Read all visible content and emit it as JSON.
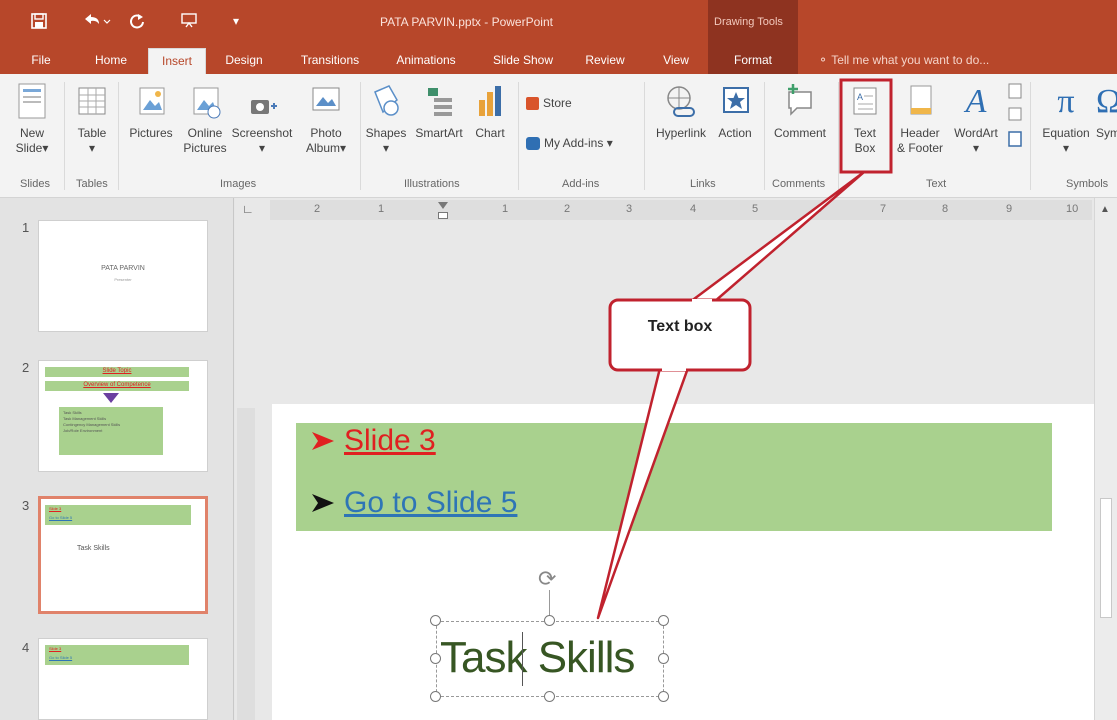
{
  "window": {
    "title": "PATA PARVIN.pptx - PowerPoint",
    "contextual_label": "Drawing Tools"
  },
  "quick_access": {
    "save_icon": "save-icon",
    "undo_icon": "undo-icon",
    "redo_icon": "redo-icon",
    "present_icon": "start-presentation-icon",
    "customize_icon": "customize-qat-icon"
  },
  "tabs": [
    "File",
    "Home",
    "Insert",
    "Design",
    "Transitions",
    "Animations",
    "Slide Show",
    "Review",
    "View",
    "Format"
  ],
  "active_tab": "Insert",
  "tell_me": "Tell me what you want to do...",
  "ribbon": {
    "new_slide": [
      "New",
      "Slide"
    ],
    "table": "Table",
    "pictures": "Pictures",
    "online_pictures": [
      "Online",
      "Pictures"
    ],
    "screenshot": "Screenshot",
    "photo_album": [
      "Photo",
      "Album"
    ],
    "shapes": "Shapes",
    "smartart": "SmartArt",
    "chart": "Chart",
    "store": "Store",
    "my_addins": "My Add-ins",
    "hyperlink": "Hyperlink",
    "action": "Action",
    "comment": "Comment",
    "text_box": [
      "Text",
      "Box"
    ],
    "header_footer": [
      "Header",
      "& Footer"
    ],
    "wordart": "WordArt",
    "equation": "Equation",
    "symbol": "Sym",
    "groups": {
      "slides": "Slides",
      "tables": "Tables",
      "images": "Images",
      "illustrations": "Illustrations",
      "addins": "Add-ins",
      "links": "Links",
      "comments": "Comments",
      "text": "Text",
      "symbols": "Symbols"
    }
  },
  "ruler_marks": [
    "2",
    "1",
    "1",
    "2",
    "3",
    "4",
    "5",
    "6",
    "7",
    "8",
    "9",
    "10"
  ],
  "slides": [
    {
      "number": "1",
      "title": "PATA PARVIN",
      "subtitle": "Presenter"
    },
    {
      "number": "2",
      "header1": "Slide Topic",
      "header2": "Overview of Competence",
      "items": [
        "Task Skills",
        "Task Management Skills",
        "Contingency Management Skills",
        "Job/Role Environment"
      ]
    },
    {
      "number": "3",
      "line1": "Slide 3",
      "line2": "Go to Slide 5",
      "body": "Task Skills"
    },
    {
      "number": "4",
      "line1": "Slide 3",
      "line2": "Go to Slide 5"
    }
  ],
  "current_slide": {
    "link1": "Slide 3",
    "link2": "Go to Slide 5",
    "textbox": "Task Skills"
  },
  "callout": {
    "label": "Text box"
  },
  "colors": {
    "accent": "#b7472a",
    "banner": "#a9d18e",
    "link_red": "#e02020",
    "link_blue": "#2e75b6",
    "textbox_text": "#375623",
    "callout_border": "#c0222e"
  }
}
